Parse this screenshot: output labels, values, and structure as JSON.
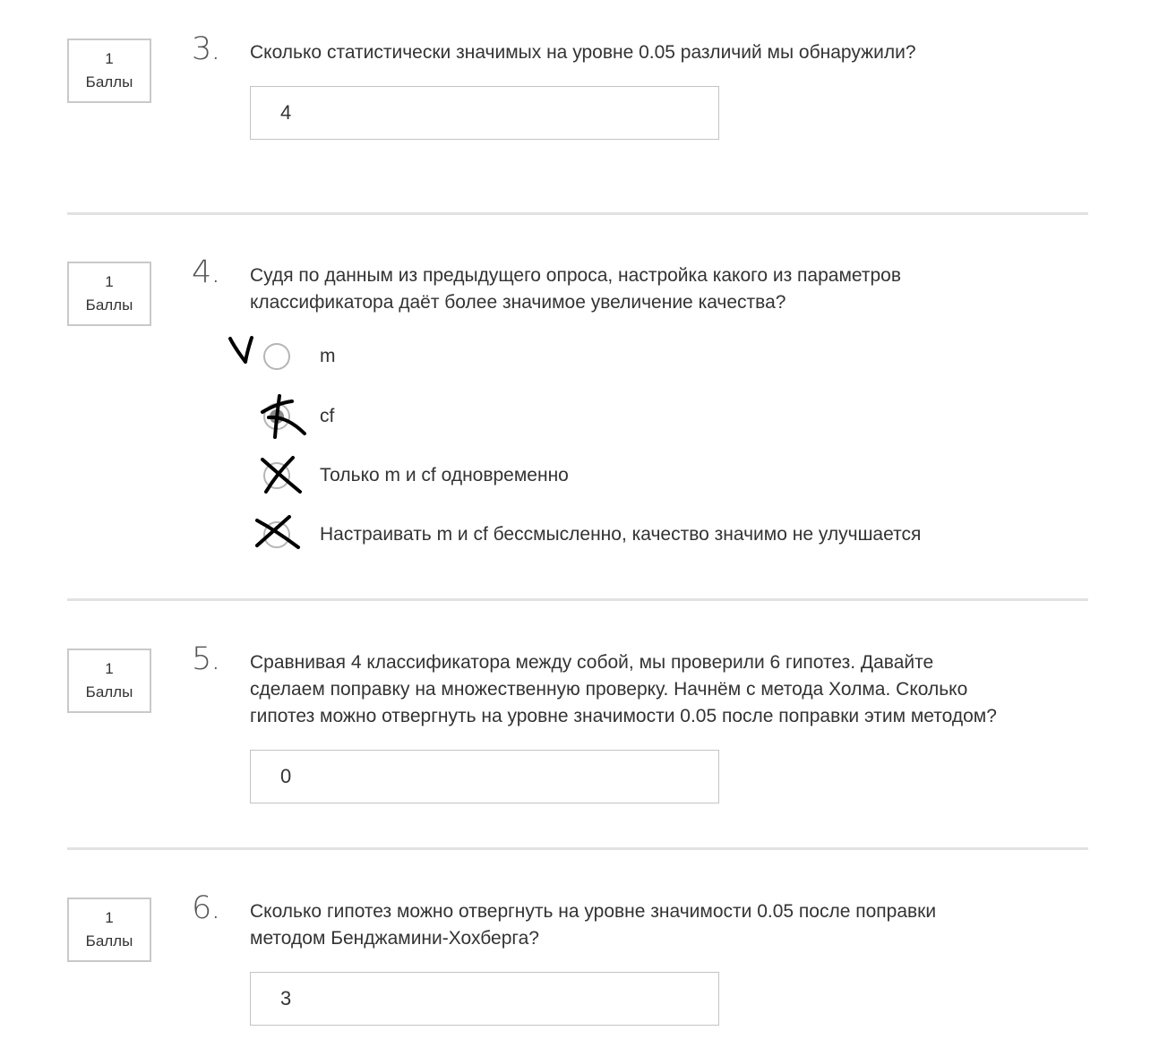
{
  "questions": [
    {
      "points_value": "1",
      "points_label": "Баллы",
      "number": "3.",
      "text": "Сколько статистически значимых на уровне 0.05 различий мы обнаружили?",
      "answer": "4"
    },
    {
      "points_value": "1",
      "points_label": "Баллы",
      "number": "4.",
      "text_lines": [
        "Судя по данным из предыдущего опроса, настройка какого из параметров",
        "классификатора даёт более значимое увеличение качества?"
      ],
      "options": [
        {
          "label": "m",
          "selected": false,
          "handwritten_mark": "check-mark"
        },
        {
          "label": "cf",
          "selected": true,
          "handwritten_mark": "cross-mark"
        },
        {
          "label": "Только m и cf одновременно",
          "selected": false,
          "handwritten_mark": "cross-mark"
        },
        {
          "label": "Настраивать m и cf бессмысленно, качество значимо не улучшается",
          "selected": false,
          "handwritten_mark": "cross-mark"
        }
      ]
    },
    {
      "points_value": "1",
      "points_label": "Баллы",
      "number": "5.",
      "text_lines": [
        "Сравнивая 4 классификатора между собой, мы проверили 6 гипотез. Давайте",
        "сделаем поправку на множественную проверку. Начнём с метода Холма. Сколько",
        "гипотез можно отвергнуть на уровне значимости 0.05 после поправки этим методом?"
      ],
      "answer": "0"
    },
    {
      "points_value": "1",
      "points_label": "Баллы",
      "number": "6.",
      "text_lines": [
        "Сколько гипотез можно отвергнуть на уровне значимости 0.05 после поправки",
        "методом Бенджамини-Хохберга?"
      ],
      "answer": "3"
    }
  ],
  "colors": {
    "border": "#c9c9c9",
    "divider": "#e2e2e2",
    "text": "#333333",
    "radio_selected": "#8a8a8a",
    "ink": "#000000"
  }
}
